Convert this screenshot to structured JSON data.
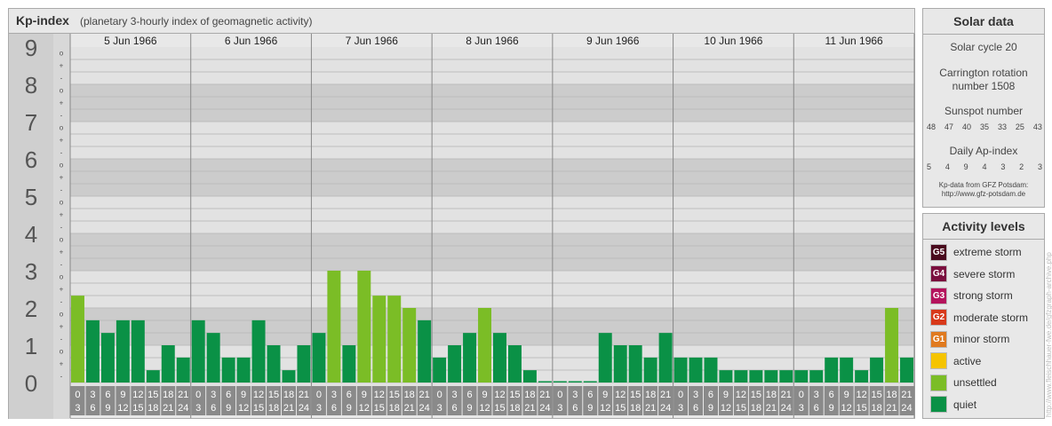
{
  "header": {
    "title": "Kp-index",
    "subtitle": "(planetary 3-hourly index of geomagnetic activity)"
  },
  "chart_data": {
    "type": "bar",
    "ylim": [
      0,
      9
    ],
    "yticks": [
      "0",
      "1",
      "2",
      "3",
      "4",
      "5",
      "6",
      "7",
      "8",
      "9"
    ],
    "minor_marks": [
      "-",
      "+",
      "o"
    ],
    "days": [
      "5 Jun 1966",
      "6 Jun 1966",
      "7 Jun 1966",
      "8 Jun 1966",
      "9 Jun 1966",
      "10 Jun 1966",
      "11 Jun 1966"
    ],
    "intervals": [
      [
        "0",
        "3"
      ],
      [
        "3",
        "6"
      ],
      [
        "6",
        "9"
      ],
      [
        "9",
        "12"
      ],
      [
        "12",
        "15"
      ],
      [
        "15",
        "18"
      ],
      [
        "18",
        "21"
      ],
      [
        "21",
        "24"
      ]
    ],
    "values": [
      [
        2.33,
        1.67,
        1.33,
        1.67,
        1.67,
        0.33,
        1.0,
        0.67
      ],
      [
        1.67,
        1.33,
        0.67,
        0.67,
        1.67,
        1.0,
        0.33,
        1.0
      ],
      [
        1.33,
        3.0,
        1.0,
        3.0,
        2.33,
        2.33,
        2.0,
        1.67
      ],
      [
        0.67,
        1.0,
        1.33,
        2.0,
        1.33,
        1.0,
        0.33,
        0.0
      ],
      [
        0.0,
        0.0,
        0.0,
        1.33,
        1.0,
        1.0,
        0.67,
        1.33
      ],
      [
        0.67,
        0.67,
        0.67,
        0.33,
        0.33,
        0.33,
        0.33,
        0.33
      ],
      [
        0.33,
        0.33,
        0.67,
        0.67,
        0.33,
        0.67,
        2.0,
        0.67
      ]
    ]
  },
  "colors": {
    "quiet": "#0a9146",
    "unsettled": "#7bbd26",
    "active": "#f5c400",
    "g1": "#e07a1f",
    "g2": "#d8391a",
    "g3": "#b4135c",
    "g4": "#7a0f3e",
    "g5": "#4a0a1e"
  },
  "solar": {
    "title": "Solar data",
    "cycle": "Solar cycle 20",
    "carrington_line1": "Carrington rotation",
    "carrington_line2": "number 1508",
    "sunspot_label": "Sunspot number",
    "sunspot_values": [
      "48",
      "47",
      "40",
      "35",
      "33",
      "25",
      "43"
    ],
    "ap_label": "Daily Ap-index",
    "ap_values": [
      "5",
      "4",
      "9",
      "4",
      "3",
      "2",
      "3"
    ],
    "credit_line1": "Kp-data from GFZ Potsdam:",
    "credit_line2": "http://www.gfz-potsdam.de"
  },
  "levels": {
    "title": "Activity levels",
    "items": [
      {
        "badge": "G5",
        "label": "extreme storm",
        "color": "#4a0a1e"
      },
      {
        "badge": "G4",
        "label": "severe storm",
        "color": "#7a0f3e"
      },
      {
        "badge": "G3",
        "label": "strong storm",
        "color": "#b4135c"
      },
      {
        "badge": "G2",
        "label": "moderate storm",
        "color": "#d8391a"
      },
      {
        "badge": "G1",
        "label": "minor storm",
        "color": "#e07a1f"
      },
      {
        "badge": "",
        "label": "active",
        "color": "#f5c400"
      },
      {
        "badge": "",
        "label": "unsettled",
        "color": "#7bbd26"
      },
      {
        "badge": "",
        "label": "quiet",
        "color": "#0a9146"
      }
    ]
  },
  "watermark": "http://www.fleischhauer-fwe.de/gfzgraph-archive.php"
}
